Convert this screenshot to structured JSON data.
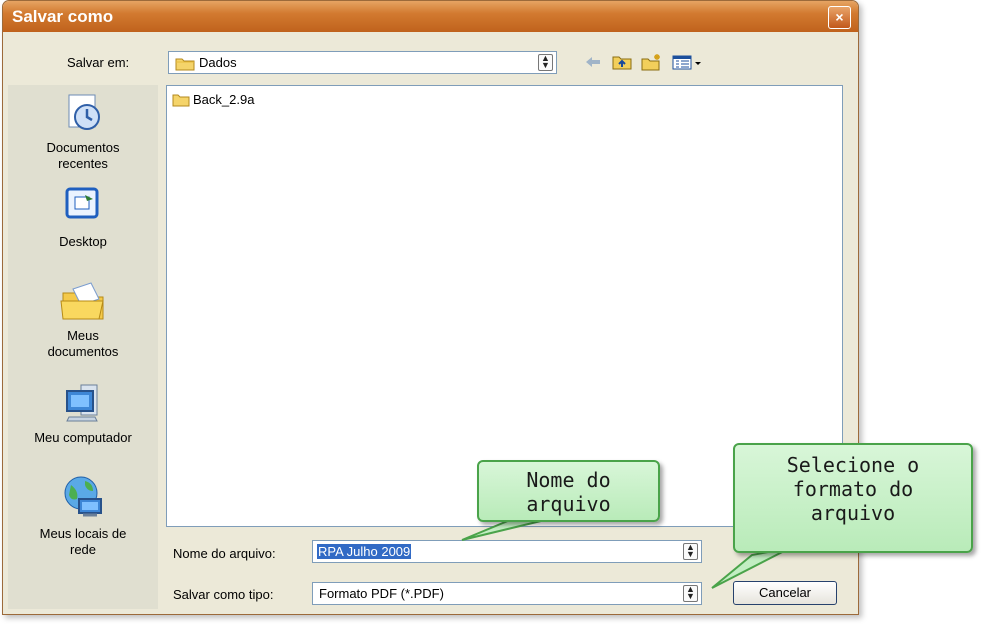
{
  "window": {
    "title": "Salvar como",
    "close_label": "×"
  },
  "top": {
    "save_in_label": "Salvar em:",
    "save_in_value": "Dados",
    "toolbar": {
      "back_icon": "arrow-left-icon",
      "up_icon": "folder-up-icon",
      "new_folder_icon": "new-folder-icon",
      "views_icon": "views-menu-icon"
    }
  },
  "places": [
    {
      "label_line1": "Documentos",
      "label_line2": "recentes",
      "icon": "recent-documents-icon"
    },
    {
      "label_line1": "Desktop",
      "label_line2": "",
      "icon": "desktop-icon"
    },
    {
      "label_line1": "Meus",
      "label_line2": "documentos",
      "icon": "my-documents-icon"
    },
    {
      "label_line1": "Meu computador",
      "label_line2": "",
      "icon": "my-computer-icon"
    },
    {
      "label_line1": "Meus locais de",
      "label_line2": "rede",
      "icon": "network-places-icon"
    }
  ],
  "files": [
    {
      "name": "Back_2.9a",
      "icon": "folder-icon"
    }
  ],
  "filename": {
    "label": "Nome do arquivo:",
    "value": "RPA Julho 2009"
  },
  "filetype": {
    "label": "Salvar como tipo:",
    "value": "Formato PDF (*.PDF)"
  },
  "buttons": {
    "cancel": "Cancelar"
  },
  "callouts": {
    "filename": {
      "line1": "Nome do",
      "line2": "arquivo"
    },
    "format": {
      "line1": "Selecione o",
      "line2": "formato do",
      "line3": "arquivo"
    }
  }
}
